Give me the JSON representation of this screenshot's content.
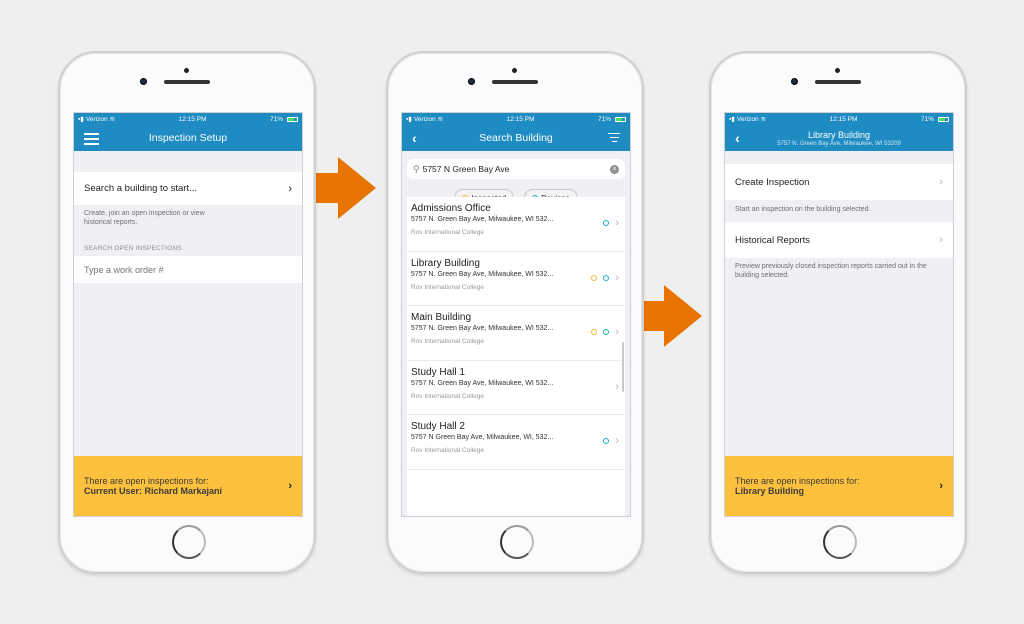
{
  "colors": {
    "brand_blue": "#1e8bc3",
    "banner_yellow": "#fdc13d",
    "arrow_orange": "#e87402",
    "inspected_ring": "#f5b732",
    "devices_ring": "#19b1b8"
  },
  "status_bar": {
    "carrier": "Verizon",
    "time": "12:15 PM",
    "battery": "71%"
  },
  "screen1": {
    "title": "Inspection Setup",
    "menu_icon": "hamburger-menu-icon",
    "search_building_label": "Search a building to start...",
    "search_hint": "Create, join an open inspection or view historical reports.",
    "section_header": "SEARCH OPEN INSPECTIONS",
    "work_order_placeholder": "Type a work order #",
    "banner_line1": "There are open inspections for:",
    "banner_line2": "Current User: Richard Markajani"
  },
  "screen2": {
    "title": "Search Building",
    "search_value": "5757 N Green Bay Ave",
    "filters": [
      {
        "label": "Inspected",
        "color": "#f5b732"
      },
      {
        "label": "Devices",
        "color": "#19b1b8"
      }
    ],
    "results": [
      {
        "name": "Admissions Office",
        "address": "5757 N. Green Bay Ave, Milwaukee, WI 532...",
        "org": "Rov International College",
        "inspected": false,
        "devices": true
      },
      {
        "name": "Library Building",
        "address": "5757 N. Green Bay Ave, Milwaukee, WI 532...",
        "org": "Rov International College",
        "inspected": true,
        "devices": true
      },
      {
        "name": "Main Building",
        "address": "5757 N. Green Bay Ave, Milwaukee, WI 532...",
        "org": "Rov International College",
        "inspected": true,
        "devices": true
      },
      {
        "name": "Study Hall 1",
        "address": "5757 N. Green Bay Ave, Milwaukee, WI 532...",
        "org": "Rov International College",
        "inspected": false,
        "devices": false
      },
      {
        "name": "Study Hall 2",
        "address": "5757 N Green Bay Ave, Milwaukee, WI, 532...",
        "org": "Rov International College",
        "inspected": false,
        "devices": true
      }
    ]
  },
  "screen3": {
    "title": "Library Building",
    "subtitle": "5757 N. Green Bay Ave, Milwaukee, WI 53209",
    "create_label": "Create Inspection",
    "create_hint": "Start an inspection on the building selected.",
    "reports_label": "Historical Reports",
    "reports_hint": "Preview previously closed inspection reports carried out in the building selected.",
    "banner_line1": "There are open inspections for:",
    "banner_line2": "Library Building"
  }
}
